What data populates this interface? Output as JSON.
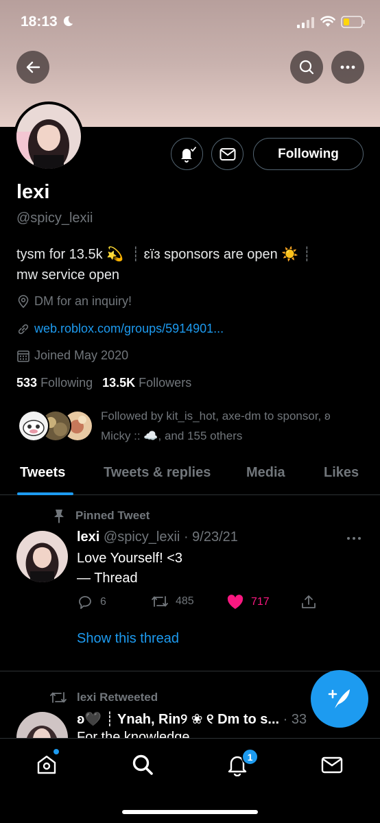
{
  "status_bar": {
    "time": "18:13"
  },
  "profile": {
    "name": "lexi",
    "handle": "@spicy_lexii",
    "bio_line1_part1": "tysm for 13.5k 💫",
    "bio_line1_part2": "ɛïɜ sponsors are open ☀️",
    "bio_line2": "mw service open",
    "location": "DM for an inquiry!",
    "website": "web.roblox.com/groups/5914901...",
    "joined": "Joined May 2020",
    "following_count": "533",
    "following_label": "Following",
    "followers_count": "13.5K",
    "followers_label": "Followers",
    "followed_by_line1": "Followed by kit_is_hot, axe-dm to sponsor, ʚ",
    "followed_by_line2": "Micky :: ☁️, and 155 others",
    "follow_button": "Following"
  },
  "tabs": [
    {
      "label": "Tweets",
      "active": true
    },
    {
      "label": "Tweets & replies",
      "active": false
    },
    {
      "label": "Media",
      "active": false
    },
    {
      "label": "Likes",
      "active": false
    }
  ],
  "pinned_tweet": {
    "pinned_label": "Pinned Tweet",
    "author_name": "lexi",
    "author_handle": "@spicy_lexii",
    "date": "· 9/23/21",
    "text_line1": "Love Yourself! <3",
    "text_line2": "— Thread",
    "replies": "6",
    "retweets": "485",
    "likes": "717",
    "show_thread": "Show this thread"
  },
  "retweet": {
    "rt_label": "lexi Retweeted",
    "author_display": "ʚ🖤 ┊ Ynah, Rin୨ ❀ ୧ Dm to s...",
    "time": "· 33",
    "text": "For the knowledge"
  },
  "notifications_badge": "1",
  "colors": {
    "accent": "#1d9bf0",
    "like": "#f91880",
    "muted": "#71767b",
    "background": "#000000"
  }
}
